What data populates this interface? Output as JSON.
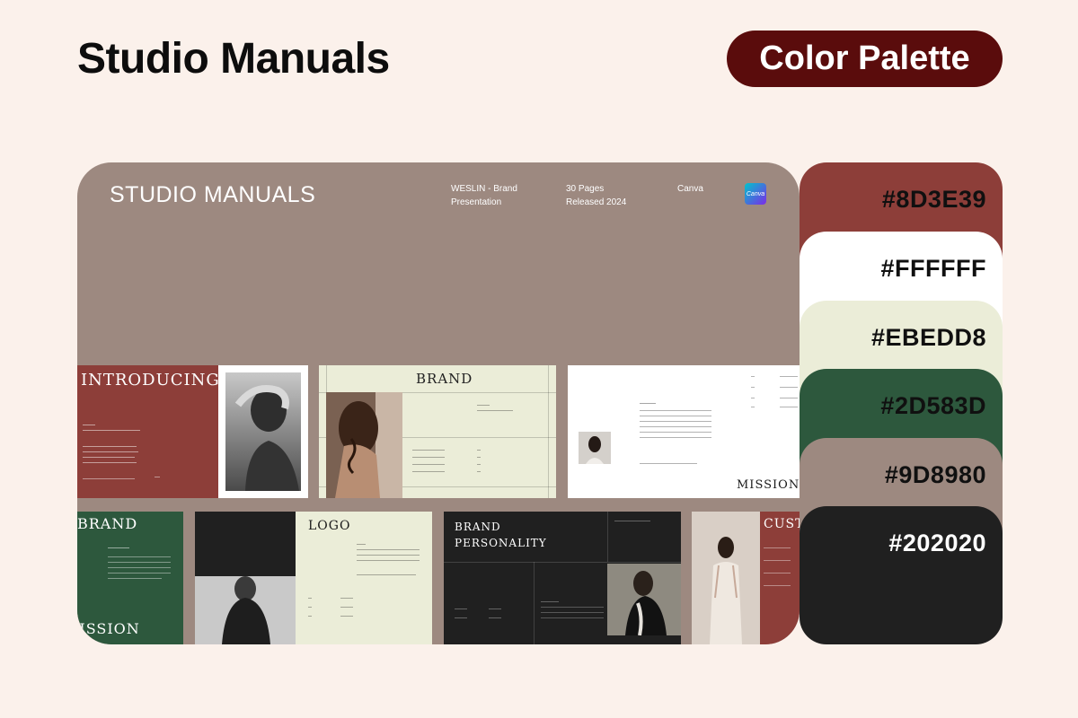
{
  "header": {
    "title": "Studio Manuals",
    "badge": "Color Palette"
  },
  "mockup": {
    "title": "STUDIO MANUALS",
    "info_1": "WESLIN - Brand\nPresentation",
    "info_2": "30 Pages\nReleased 2024",
    "info_3": "Canva",
    "app_icon": "Canva"
  },
  "slides": {
    "introducing": "INTRODUCING",
    "brand": "BRAND",
    "mission": "MISSION",
    "brand_green": "BRAND",
    "mission_green": "MISSION",
    "logo": "LOGO",
    "brand_personality_1": "BRAND",
    "brand_personality_2": "PERSONALITY",
    "customer": "CUST"
  },
  "palette": [
    {
      "hex": "#8D3E39",
      "text_color": "#101010"
    },
    {
      "hex": "#FFFFFF",
      "text_color": "#101010"
    },
    {
      "hex": "#EBEDD8",
      "text_color": "#101010"
    },
    {
      "hex": "#2D583D",
      "text_color": "#101010"
    },
    {
      "hex": "#9D8980",
      "text_color": "#101010"
    },
    {
      "hex": "#202020",
      "text_color": "#FFFFFF"
    }
  ]
}
